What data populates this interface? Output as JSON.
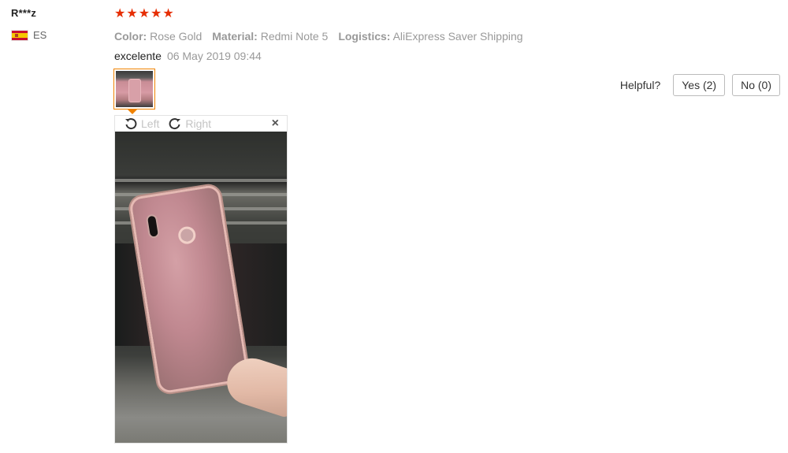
{
  "reviewer": {
    "name": "R***z",
    "country_code": "ES",
    "flag": "spain-flag-icon"
  },
  "review": {
    "rating": 5,
    "star_icon": "star-icon",
    "star_color": "#e62e04",
    "attributes": [
      {
        "label": "Color:",
        "value": "Rose Gold"
      },
      {
        "label": "Material:",
        "value": "Redmi Note 5"
      },
      {
        "label": "Logistics:",
        "value": "AliExpress Saver Shipping"
      }
    ],
    "comment": "excelente",
    "date": "06 May 2019 09:44"
  },
  "helpful": {
    "label": "Helpful?",
    "yes_label": "Yes (2)",
    "no_label": "No (0)"
  },
  "viewer": {
    "rotate_left_label": "Left",
    "rotate_right_label": "Right",
    "close_symbol": "×",
    "thumb_border_color": "#f08200"
  }
}
